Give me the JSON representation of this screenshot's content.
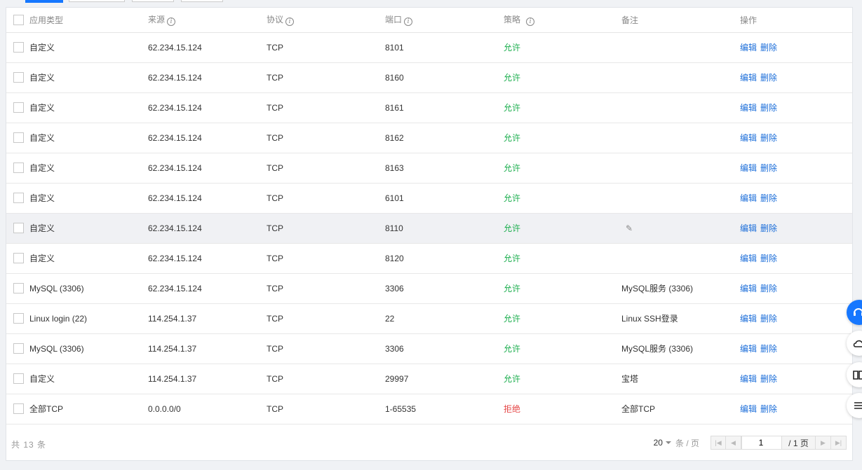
{
  "headers": {
    "type": "应用类型",
    "source": "来源",
    "protocol": "协议",
    "port": "端口",
    "policy": "策略",
    "note": "备注",
    "action": "操作"
  },
  "rows": [
    {
      "type": "自定义",
      "source": "62.234.15.124",
      "protocol": "TCP",
      "port": "8101",
      "policy": "允许",
      "note": ""
    },
    {
      "type": "自定义",
      "source": "62.234.15.124",
      "protocol": "TCP",
      "port": "8160",
      "policy": "允许",
      "note": ""
    },
    {
      "type": "自定义",
      "source": "62.234.15.124",
      "protocol": "TCP",
      "port": "8161",
      "policy": "允许",
      "note": ""
    },
    {
      "type": "自定义",
      "source": "62.234.15.124",
      "protocol": "TCP",
      "port": "8162",
      "policy": "允许",
      "note": ""
    },
    {
      "type": "自定义",
      "source": "62.234.15.124",
      "protocol": "TCP",
      "port": "8163",
      "policy": "允许",
      "note": ""
    },
    {
      "type": "自定义",
      "source": "62.234.15.124",
      "protocol": "TCP",
      "port": "6101",
      "policy": "允许",
      "note": ""
    },
    {
      "type": "自定义",
      "source": "62.234.15.124",
      "protocol": "TCP",
      "port": "8110",
      "policy": "允许",
      "note": ""
    },
    {
      "type": "自定义",
      "source": "62.234.15.124",
      "protocol": "TCP",
      "port": "8120",
      "policy": "允许",
      "note": ""
    },
    {
      "type": "MySQL (3306)",
      "source": "62.234.15.124",
      "protocol": "TCP",
      "port": "3306",
      "policy": "允许",
      "note": "MySQL服务 (3306)"
    },
    {
      "type": "Linux login (22)",
      "source": "114.254.1.37",
      "protocol": "TCP",
      "port": "22",
      "policy": "允许",
      "note": "Linux SSH登录"
    },
    {
      "type": "MySQL (3306)",
      "source": "114.254.1.37",
      "protocol": "TCP",
      "port": "3306",
      "policy": "允许",
      "note": "MySQL服务 (3306)"
    },
    {
      "type": "自定义",
      "source": "114.254.1.37",
      "protocol": "TCP",
      "port": "29997",
      "policy": "允许",
      "note": "宝塔"
    },
    {
      "type": "全部TCP",
      "source": "0.0.0.0/0",
      "protocol": "TCP",
      "port": "1-65535",
      "policy": "拒绝",
      "note": "全部TCP"
    }
  ],
  "actions": {
    "edit": "编辑",
    "delete": "删除"
  },
  "footer": {
    "total": "共 13 条",
    "page_size": "20",
    "per_page_label": "条 / 页",
    "page_value": "1",
    "page_total": "/ 1 页"
  },
  "colors": {
    "allow": "#1aae4d",
    "deny": "#e54545",
    "link": "#1a6dd9",
    "accent": "#1677ff"
  },
  "icons": {
    "header_info": "info-circle-icon",
    "note_edit": "pencil-icon",
    "float": [
      "headset-icon",
      "cloud-icon",
      "book-icon",
      "list-icon"
    ]
  }
}
